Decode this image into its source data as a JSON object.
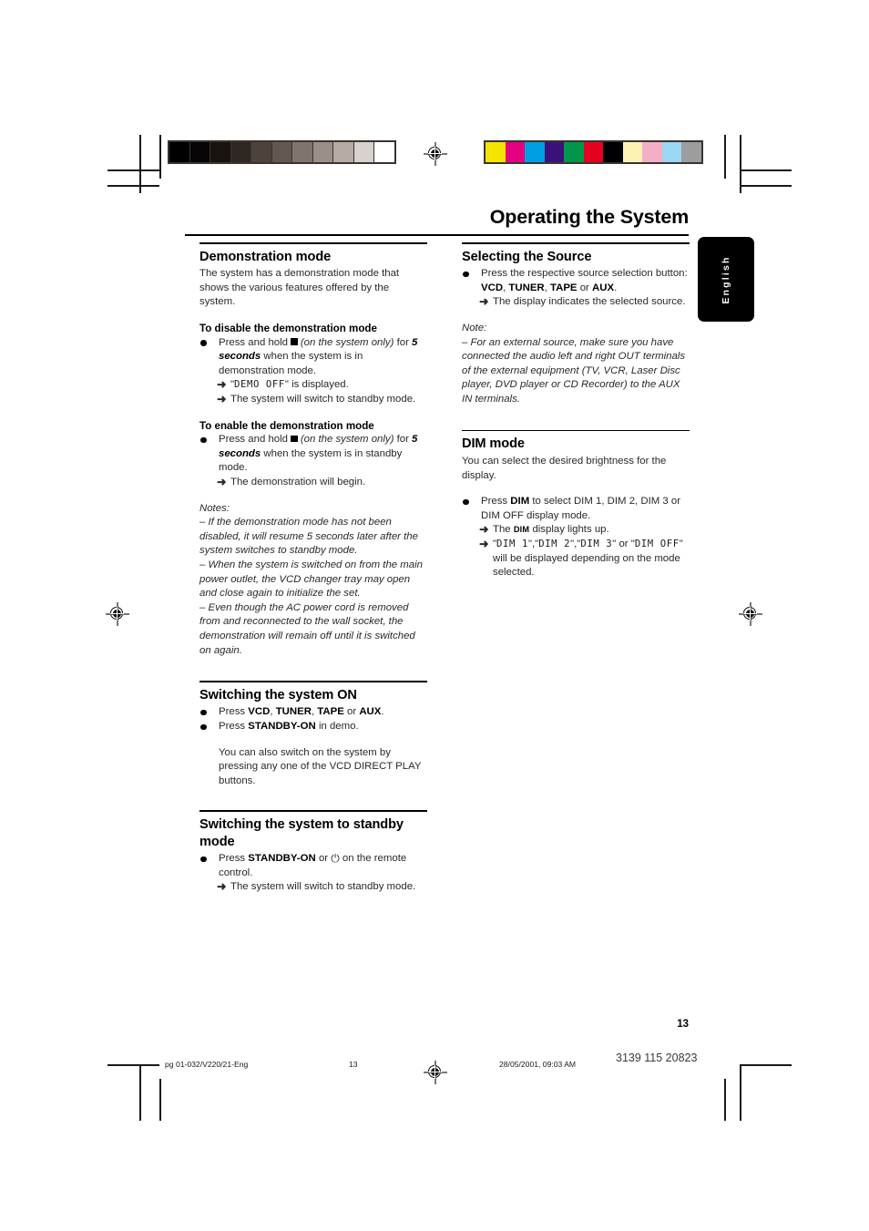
{
  "header": {
    "title": "Operating the System",
    "language_tab": "English"
  },
  "left_column": {
    "sections": [
      {
        "title": "Demonstration mode",
        "intro": "The system has a demonstration mode that shows the various features offered by the system.",
        "sub1_title": "To disable the demonstration mode",
        "sub1_body_pre": "Press and hold",
        "sub1_body_italic": "(on the system only)",
        "sub1_body_for": "for",
        "sub1_bold_5": "5 seconds",
        "sub1_body_post": "when the system is in demonstration mode.",
        "sub1_arrow1_lcd": "DEMO OFF",
        "sub1_arrow1_post": "is displayed.",
        "sub1_arrow2": "The system will switch to standby mode.",
        "sub2_title": "To enable the demonstration mode",
        "sub2_body_pre": "Press and hold",
        "sub2_body_italic": "(on the system only)",
        "sub2_body_for": "for",
        "sub2_bold_5": "5 seconds",
        "sub2_body_post": "when the system is in standby mode.",
        "sub2_arrow1": "The demonstration will begin.",
        "notes_label": "Notes:",
        "note1": "–  If the demonstration mode has not been disabled, it will resume 5 seconds later after the system switches to standby mode.",
        "note2": "–  When the system is switched on from the main power outlet, the VCD changer tray may open and close again to initialize the set.",
        "note3": "–  Even though the AC power cord is removed from and reconnected to the wall socket, the demonstration will remain off until it is switched on again."
      },
      {
        "title": "Switching the system ON",
        "b1_press": "Press",
        "b1_vcd": "VCD",
        "b1_tuner": "TUNER",
        "b1_tape": "TAPE",
        "b1_or": "or",
        "b1_aux": "AUX",
        "b2_press": "Press",
        "b2_standby": "STANDBY-ON",
        "b2_post": "in demo.",
        "extra": "You can also switch on the system by pressing any one of the VCD DIRECT PLAY buttons."
      },
      {
        "title": "Switching the system to standby mode",
        "press": "Press",
        "standby": "STANDBY-ON",
        "or": "or",
        "power_icon": "⏻",
        "post": "on the remote control.",
        "arrow1": "The system will switch to standby mode."
      }
    ]
  },
  "right_column": {
    "sections": [
      {
        "title": "Selecting the Source",
        "b1_pre": "Press the respective source selection button:",
        "b1_vcd": "VCD",
        "b1_tuner": "TUNER",
        "b1_tape": "TAPE",
        "b1_or": "or",
        "b1_aux": "AUX",
        "arrow1": "The display indicates the selected source.",
        "note_label": "Note:",
        "note1": "–  For an external source, make sure you have connected the audio left and right OUT terminals of the external equipment (TV, VCR, Laser Disc player, DVD player or CD Recorder) to the AUX IN terminals."
      },
      {
        "title": "DIM mode",
        "intro": "You can select the desired brightness for the display.",
        "b1_press": "Press",
        "b1_dim": "DIM",
        "b1_post": "to select DIM 1, DIM 2, DIM 3 or DIM OFF display mode.",
        "arrow1_pre": "The",
        "arrow1_dim": "DIM",
        "arrow1_post": "display lights up.",
        "arrow2_lcd1": "DIM  1",
        "arrow2_lcd2": "DIM 2",
        "arrow2_lcd3": "DIM 3",
        "arrow2_or": "or",
        "arrow2_lcd4": "DIM OFF",
        "arrow2_post": "will be displayed depending on the mode selected."
      }
    ]
  },
  "footer": {
    "folio": "13",
    "file": "pg 01-032/V220/21-Eng",
    "page": "13",
    "date": "28/05/2001, 09:03 AM",
    "part_number": "3139 115 20823"
  },
  "calibration": {
    "gray_bar": [
      "#000000",
      "#060404",
      "#19130f",
      "#2f2723",
      "#4d433d",
      "#635850",
      "#7e756c",
      "#9a908a",
      "#b6aca6",
      "#d7d2ce",
      "#ffffff"
    ],
    "color_bar": [
      "#f5e400",
      "#e4007f",
      "#009fe3",
      "#3b1179",
      "#00974b",
      "#e50020",
      "#000000",
      "#fbf3b4",
      "#f6aec7",
      "#9bd6f4",
      "#9d9d9d"
    ]
  }
}
